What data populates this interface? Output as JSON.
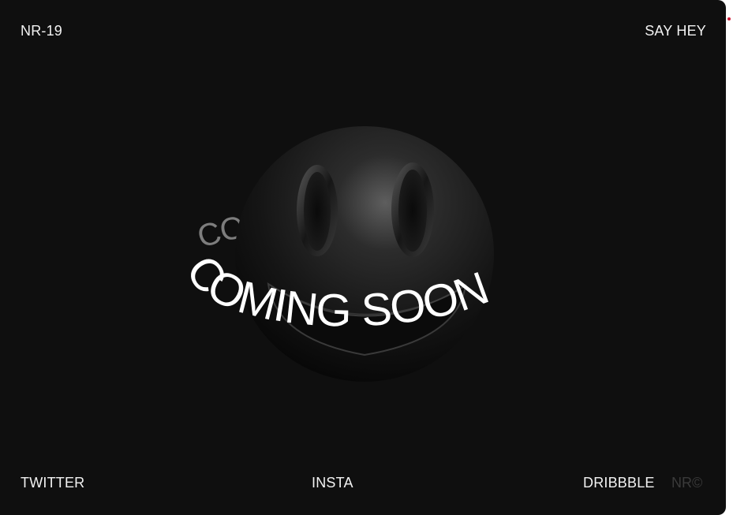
{
  "header": {
    "brand": "NR-19",
    "contact_link": "SAY HEY"
  },
  "hero": {
    "ring_text": "COMING SOON",
    "icon": "smiley-face-3d-icon"
  },
  "footer": {
    "links": [
      "TWITTER",
      "INSTA",
      "DRIBBBLE"
    ],
    "copyright": "NR©"
  },
  "colors": {
    "background": "#0f0f0f",
    "text": "#f2f2f2",
    "muted": "#3a3a3a",
    "accent_dot": "#d11f3a"
  }
}
